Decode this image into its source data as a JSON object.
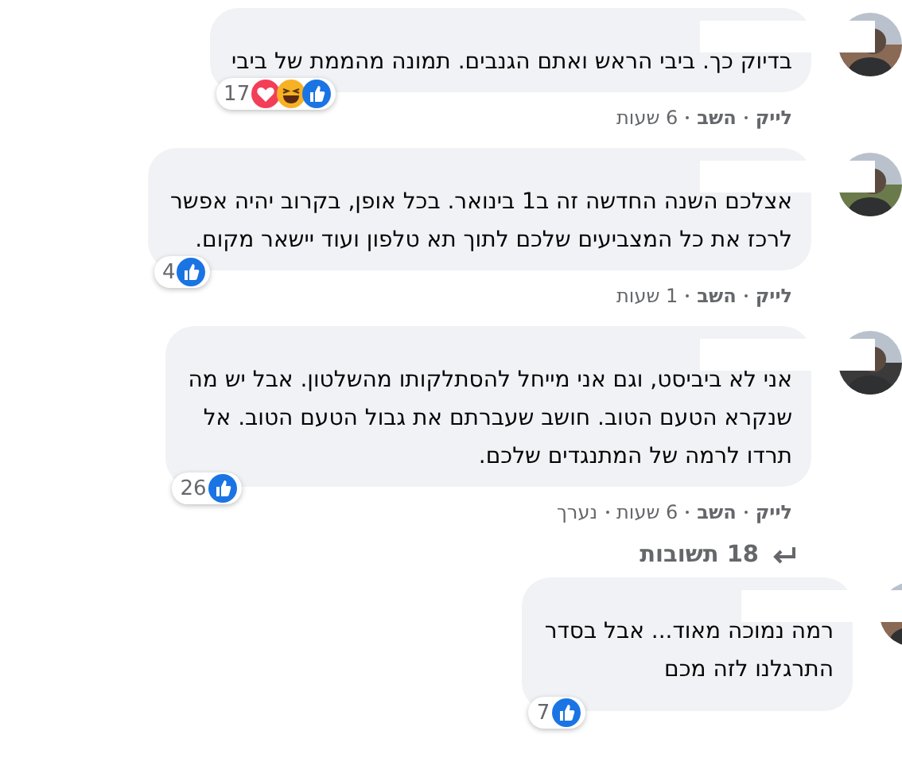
{
  "comments": [
    {
      "kind": "comment",
      "text": "בדיוק כך. ביבי הראש ואתם הגנבים. תמונה מהממת של ביבי",
      "reactions": {
        "count": "17",
        "icons": [
          {
            "kind": "like"
          },
          {
            "kind": "haha"
          },
          {
            "kind": "love"
          }
        ]
      },
      "actions": [
        "לייק",
        "השב"
      ],
      "time": "6 שעות"
    },
    {
      "kind": "comment",
      "text": "אצלכם השנה החדשה זה ב1 בינואר. בכל אופן, בקרוב יהיה אפשר\nלרכז את כל המצביעים שלכם לתוך תא טלפון ועוד יישאר מקום.",
      "reactions": {
        "count": "4",
        "icons": [
          {
            "kind": "like"
          }
        ]
      },
      "actions": [
        "לייק",
        "השב"
      ],
      "time": "1 שעות"
    },
    {
      "kind": "comment",
      "text": "אני לא ביביסט, וגם אני מייחל להסתלקותו מהשלטון. אבל יש מה\nשנקרא הטעם הטוב. חושב שעברתם את גבול הטעם הטוב. אל\nתרדו לרמה של המתנגדים שלכם.",
      "reactions": {
        "count": "26",
        "icons": [
          {
            "kind": "like"
          }
        ]
      },
      "actions": [
        "לייק",
        "השב"
      ],
      "time": "6 שעות",
      "edited": "נערך"
    },
    {
      "kind": "replies_link",
      "label": "18 תשובות"
    },
    {
      "kind": "reply",
      "text": "רמה נמוכה מאוד... אבל בסדר\nהתרגלנו לזה מכם",
      "reactions": {
        "count": "7",
        "icons": [
          {
            "kind": "like"
          }
        ]
      }
    }
  ]
}
